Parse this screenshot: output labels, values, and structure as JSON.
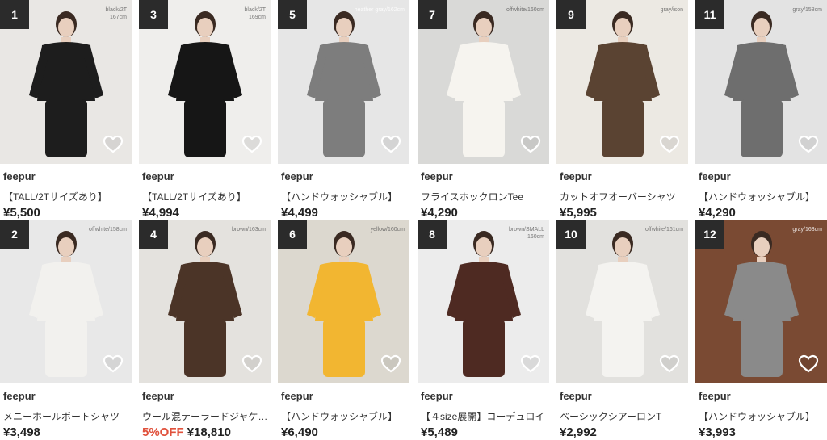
{
  "products": [
    {
      "rank": "1",
      "variant": "black/2T\n167cm",
      "brand": "feepur",
      "title": "【TALL/2Tサイズあり】",
      "price": "¥5,500",
      "discount": "",
      "bg": "#e9e7e4",
      "figure": "#1d1d1d",
      "light": false
    },
    {
      "rank": "3",
      "variant": "black/2T\n169cm",
      "brand": "feepur",
      "title": "【TALL/2Tサイズあり】",
      "price": "¥4,994",
      "discount": "",
      "bg": "#efeeec",
      "figure": "#161616",
      "light": false
    },
    {
      "rank": "5",
      "variant": "heather gray/162cm",
      "brand": "feepur",
      "title": "【ハンドウォッシャブル】",
      "price": "¥4,499",
      "discount": "",
      "bg": "#e6e6e6",
      "figure": "#7d7d7d",
      "light": true
    },
    {
      "rank": "7",
      "variant": "offwhite/160cm",
      "brand": "feepur",
      "title": "フライスホックロンTee",
      "price": "¥4,290",
      "discount": "",
      "bg": "#d9d9d7",
      "figure": "#f6f4ef",
      "light": false
    },
    {
      "rank": "9",
      "variant": "gray/ison",
      "brand": "feepur",
      "title": "カットオフオーバーシャツ",
      "price": "¥5,995",
      "discount": "",
      "bg": "#ece9e3",
      "figure": "#5a4332",
      "light": false
    },
    {
      "rank": "11",
      "variant": "gray/158cm",
      "brand": "feepur",
      "title": "【ハンドウォッシャブル】",
      "price": "¥4,290",
      "discount": "",
      "bg": "#e3e3e3",
      "figure": "#6e6e6e",
      "light": false
    },
    {
      "rank": "2",
      "variant": "offwhite/158cm",
      "brand": "feepur",
      "title": "メニーホールボートシャツ",
      "price": "¥3,498",
      "discount": "",
      "bg": "#e8e8e8",
      "figure": "#f2f1ee",
      "light": false
    },
    {
      "rank": "4",
      "variant": "brown/163cm",
      "brand": "feepur",
      "title": "ウール混テーラードジャケット",
      "price": "¥18,810",
      "discount": "5%OFF",
      "bg": "#e4e2de",
      "figure": "#4b3427",
      "light": false
    },
    {
      "rank": "6",
      "variant": "yellow/160cm",
      "brand": "feepur",
      "title": "【ハンドウォッシャブル】",
      "price": "¥6,490",
      "discount": "",
      "bg": "#dcd8cf",
      "figure": "#f2b631",
      "light": false
    },
    {
      "rank": "8",
      "variant": "brown/SMALL\n160cm",
      "brand": "feepur",
      "title": "【４size展開】コーデュロイ",
      "price": "¥5,489",
      "discount": "",
      "bg": "#ececec",
      "figure": "#4e2a22",
      "light": false
    },
    {
      "rank": "10",
      "variant": "offwhite/161cm",
      "brand": "feepur",
      "title": "ベーシックシアーロンT",
      "price": "¥2,992",
      "discount": "",
      "bg": "#e2e1de",
      "figure": "#f4f3f0",
      "light": false
    },
    {
      "rank": "12",
      "variant": "gray/163cm",
      "brand": "feepur",
      "title": "【ハンドウォッシャブル】",
      "price": "¥3,993",
      "discount": "",
      "bg": "#7a4a33",
      "figure": "#8a8a8a",
      "light": true
    }
  ]
}
